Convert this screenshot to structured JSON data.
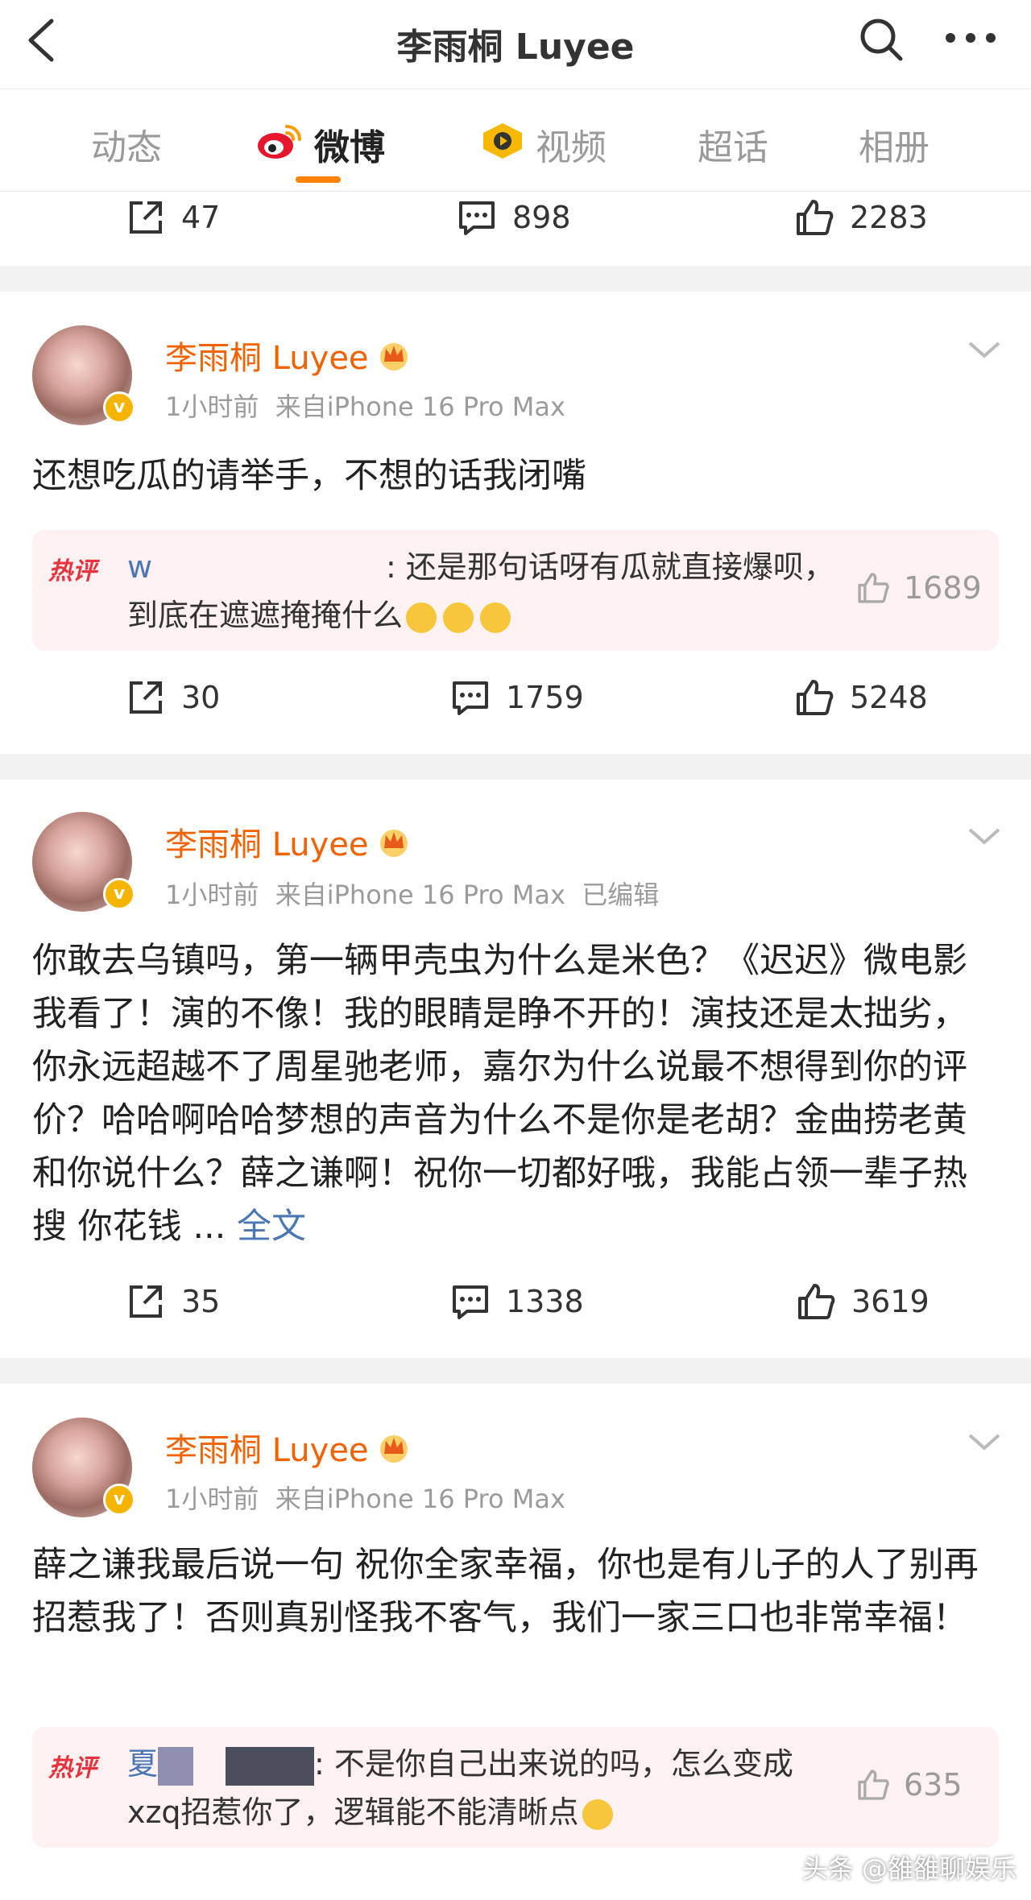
{
  "header": {
    "title": "李雨桐 Luyee"
  },
  "tabs": [
    {
      "label": "动态"
    },
    {
      "label": "微博"
    },
    {
      "label": "视频"
    },
    {
      "label": "超话"
    },
    {
      "label": "相册"
    }
  ],
  "top_actions": {
    "repost": "47",
    "comment": "898",
    "like": "2283"
  },
  "posts": [
    {
      "username": "李雨桐 Luyee",
      "time": "1小时前",
      "source": "来自iPhone 16 Pro Max",
      "edited": "",
      "text": "还想吃瓜的请举手，不想的话我闭嘴",
      "more": "",
      "hot_comment": {
        "tag": "热评",
        "user": "w",
        "text_line1": ": 还是那句话呀有瓜就直接爆呗，",
        "text_line2": "到底在遮遮掩掩什么",
        "likes": "1689"
      },
      "repost": "30",
      "comment": "1759",
      "like": "5248"
    },
    {
      "username": "李雨桐 Luyee",
      "time": "1小时前",
      "source": "来自iPhone 16 Pro Max",
      "edited": "已编辑",
      "text": "你敢去乌镇吗，第一辆甲壳虫为什么是米色？《迟迟》微电影我看了！演的不像！我的眼睛是睁不开的！演技还是太拙劣，你永远超越不了周星驰老师，嘉尔为什么说最不想得到你的评价？哈哈啊哈哈梦想的声音为什么不是你是老胡？金曲捞老黄和你说什么？薛之谦啊！祝你一切都好哦，我能占领一辈子热搜 你花钱 ... ",
      "more": "全文",
      "repost": "35",
      "comment": "1338",
      "like": "3619"
    },
    {
      "username": "李雨桐 Luyee",
      "time": "1小时前",
      "source": "来自iPhone 16 Pro Max",
      "edited": "",
      "text": "薛之谦我最后说一句 祝你全家幸福，你也是有儿子的人了别再招惹我了！否则真别怪我不客气，我们一家三口也非常幸福！",
      "more": "",
      "hot_comment": {
        "tag": "热评",
        "user": "夏",
        "text_line1": ": 不是你自己出来说的吗，怎么变成",
        "text_line2": "xzq招惹你了，逻辑能不能清晰点",
        "likes": "635"
      }
    }
  ],
  "watermark": "头条 @雒雒聊娱乐"
}
